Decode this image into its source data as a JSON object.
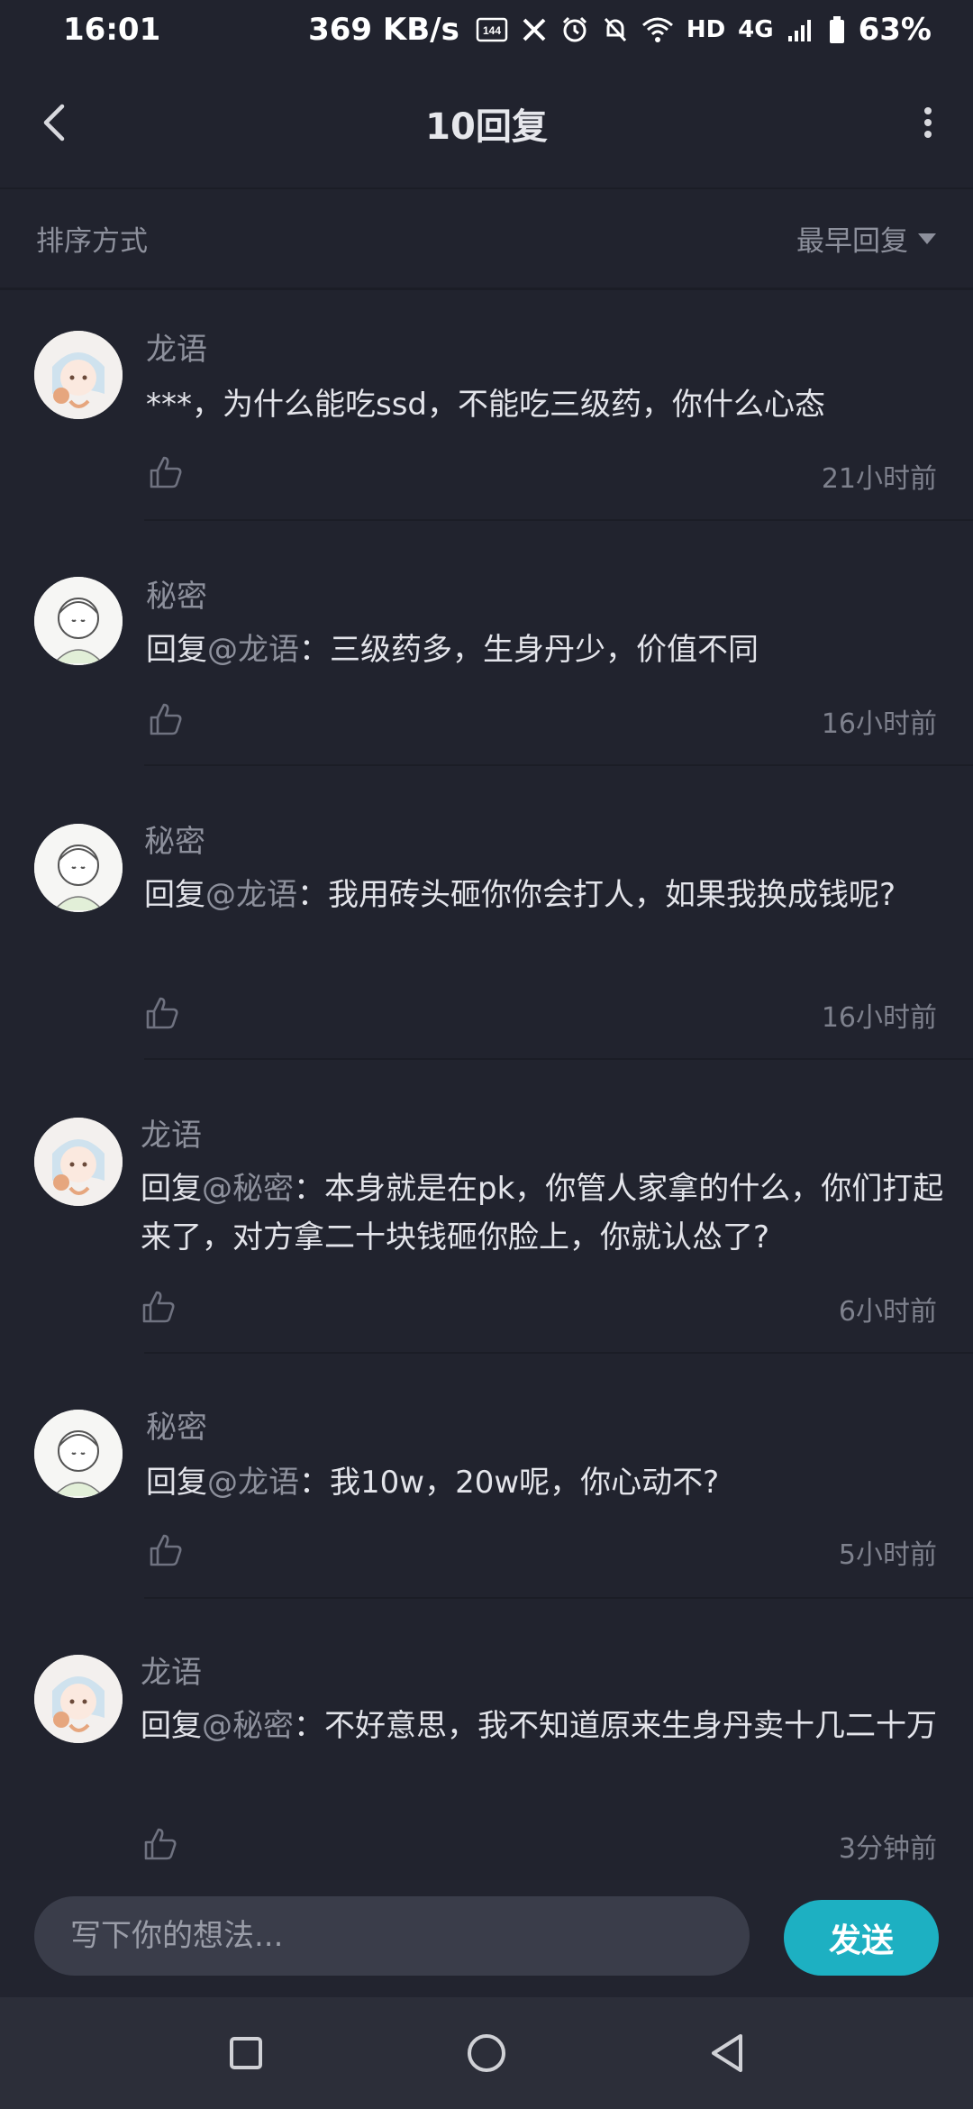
{
  "status_bar": {
    "time": "16:01",
    "speed": "369 KB/s",
    "refresh_badge": "144",
    "network_hd": "HD",
    "network_gen": "4G",
    "battery": "63%"
  },
  "header": {
    "title": "10回复",
    "back_icon": "chevron-left-icon",
    "more_icon": "vertical-ellipsis-icon"
  },
  "sort": {
    "label": "排序方式",
    "value": "最早回复"
  },
  "comments": [
    {
      "name": "龙语",
      "avatar": "anime-girl-avatar",
      "prefix": "",
      "mention": "",
      "colon": "",
      "text": "***，为什么能吃ssd，不能吃三级药，你什么心态",
      "time": "21小时前"
    },
    {
      "name": "秘密",
      "avatar": "sketch-boy-avatar",
      "prefix": "回复",
      "mention": "@龙语",
      "colon": "：",
      "text": "三级药多，生身丹少，价值不同",
      "time": "16小时前"
    },
    {
      "name": "秘密",
      "avatar": "sketch-boy-avatar",
      "prefix": "回复",
      "mention": "@龙语",
      "colon": "：",
      "text": "我用砖头砸你你会打人，如果我换成钱呢?",
      "time": "16小时前"
    },
    {
      "name": "龙语",
      "avatar": "anime-girl-avatar",
      "prefix": "回复",
      "mention": "@秘密",
      "colon": "：",
      "text": "本身就是在pk，你管人家拿的什么，你们打起来了，对方拿二十块钱砸你脸上，你就认怂了?",
      "time": "6小时前"
    },
    {
      "name": "秘密",
      "avatar": "sketch-boy-avatar",
      "prefix": "回复",
      "mention": "@龙语",
      "colon": "：",
      "text": "我10w，20w呢，你心动不?",
      "time": "5小时前"
    },
    {
      "name": "龙语",
      "avatar": "anime-girl-avatar",
      "prefix": "回复",
      "mention": "@秘密",
      "colon": "：",
      "text": "不好意思，我不知道原来生身丹卖十几二十万",
      "time": "3分钟前"
    }
  ],
  "input": {
    "placeholder": "写下你的想法...",
    "send_label": "发送"
  },
  "colors": {
    "background": "#21232e",
    "accent": "#1db0c2",
    "muted_text": "#8d909c"
  }
}
